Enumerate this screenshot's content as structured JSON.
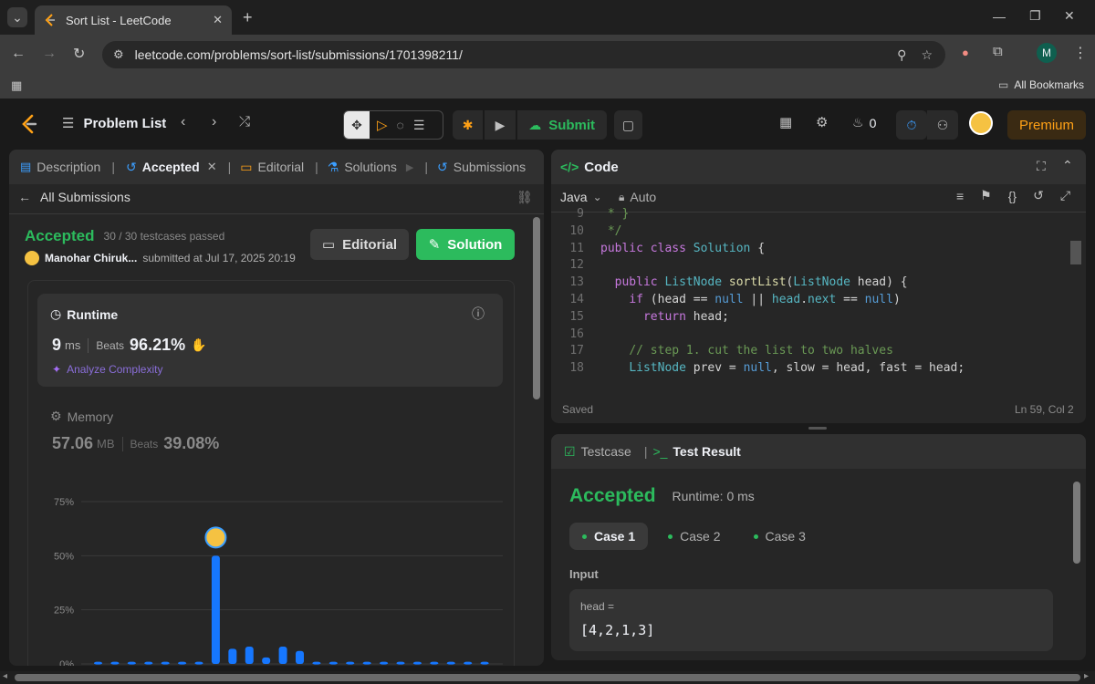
{
  "browser": {
    "tab_title": "Sort List - LeetCode",
    "url": "leetcode.com/problems/sort-list/submissions/1701398211/",
    "all_bookmarks": "All Bookmarks",
    "profile_initial": "M"
  },
  "nav": {
    "problem_list": "Problem List",
    "submit": "Submit",
    "streak_count": "0",
    "premium": "Premium"
  },
  "left": {
    "tabs": [
      "Description",
      "Accepted",
      "Editorial",
      "Solutions",
      "Submissions"
    ],
    "all_submissions": "All Submissions",
    "status": "Accepted",
    "testcases": "30 / 30 testcases passed",
    "author": "Manohar Chiruk...",
    "submitted_at": "submitted at Jul 17, 2025 20:19",
    "editorial_btn": "Editorial",
    "solution_btn": "Solution",
    "runtime": {
      "label": "Runtime",
      "value": "9",
      "unit": "ms",
      "beats_label": "Beats",
      "beats_value": "96.21%",
      "analyze": "Analyze Complexity"
    },
    "memory": {
      "label": "Memory",
      "value": "57.06",
      "unit": "MB",
      "beats_label": "Beats",
      "beats_value": "39.08%"
    }
  },
  "chart_data": {
    "type": "bar",
    "ylabels": [
      "75%",
      "50%",
      "25%",
      "0%"
    ],
    "ylim": [
      0,
      75
    ],
    "values": [
      1,
      1,
      1,
      1,
      1,
      1,
      1,
      50,
      7,
      8,
      3,
      8,
      6,
      1,
      1,
      1,
      1,
      1,
      1,
      1,
      1,
      1,
      1,
      1
    ],
    "highlight_index": 7,
    "color": "#1677ff"
  },
  "code": {
    "title": "Code",
    "language": "Java",
    "mode": "Auto",
    "lines": [
      {
        "n": "9",
        "html": "<span class=\"cm\"> * }</span>"
      },
      {
        "n": "10",
        "html": "<span class=\"cm\"> */</span>"
      },
      {
        "n": "11",
        "html": "<span class=\"kw\">public</span> <span class=\"kw\">class</span> <span class=\"ty\">Solution</span> {"
      },
      {
        "n": "12",
        "html": ""
      },
      {
        "n": "13",
        "html": "  <span class=\"kw\">public</span> <span class=\"ty\">ListNode</span> <span class=\"fn\">sortList</span>(<span class=\"ty\">ListNode</span> head) {"
      },
      {
        "n": "14",
        "html": "    <span class=\"kw\">if</span> (head == <span class=\"nl\">null</span> || <span class=\"ty\">head</span>.<span class=\"ty\">next</span> == <span class=\"nl\">null</span>)"
      },
      {
        "n": "15",
        "html": "      <span class=\"kw\">return</span> head;"
      },
      {
        "n": "16",
        "html": ""
      },
      {
        "n": "17",
        "html": "    <span class=\"cm\">// step 1. cut the list to two halves</span>"
      },
      {
        "n": "18",
        "html": "    <span class=\"ty\">ListNode</span> prev = <span class=\"nl\">null</span>, slow = head, fast = head;"
      }
    ],
    "saved": "Saved",
    "cursor": "Ln 59, Col 2"
  },
  "result": {
    "tab_testcase": "Testcase",
    "tab_result": "Test Result",
    "status": "Accepted",
    "runtime": "Runtime: 0 ms",
    "cases": [
      "Case 1",
      "Case 2",
      "Case 3"
    ],
    "input_label": "Input",
    "var_name": "head =",
    "var_value": "[4,2,1,3]"
  }
}
